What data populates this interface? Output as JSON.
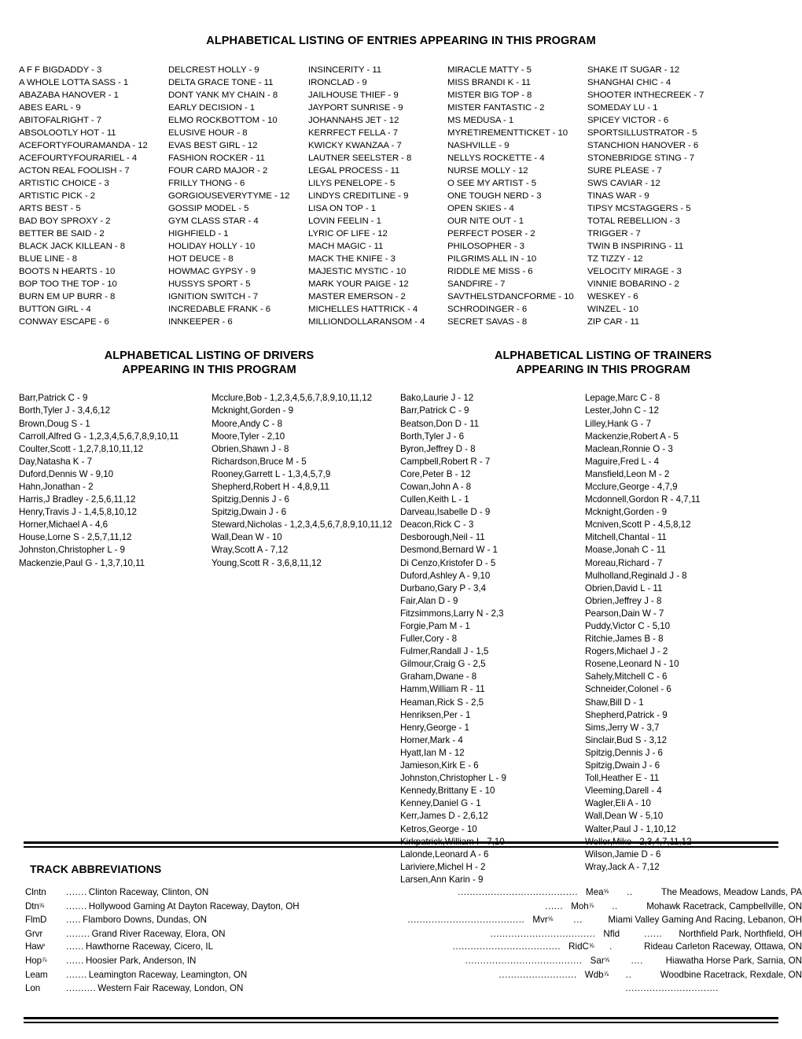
{
  "entries_section": {
    "title": "ALPHABETICAL LISTING OF ENTRIES APPEARING IN THIS PROGRAM",
    "columns": [
      [
        "A F F BIGDADDY - 3",
        "A WHOLE LOTTA SASS - 1",
        "ABAZABA HANOVER - 1",
        "ABES EARL - 9",
        "ABITOFALRIGHT - 7",
        "ABSOLOOTLY HOT - 11",
        "ACEFORTYFOURAMANDA - 12",
        "ACEFOURTYFOURARIEL - 4",
        "ACTON REAL FOOLISH - 7",
        "ARTISTIC CHOICE - 3",
        "ARTISTIC PICK - 2",
        "ARTS BEST - 5",
        "BAD BOY SPROXY - 2",
        "BETTER BE SAID - 2",
        "BLACK JACK KILLEAN - 8",
        "BLUE LINE - 8",
        "BOOTS N HEARTS - 10",
        "BOP TOO THE TOP - 10",
        "BURN EM UP BURR - 8",
        "BUTTON GIRL - 4",
        "CONWAY ESCAPE - 6"
      ],
      [
        "DELCREST HOLLY - 9",
        "DELTA GRACE TONE - 11",
        "DONT YANK MY CHAIN - 8",
        "EARLY DECISION - 1",
        "ELMO ROCKBOTTOM - 10",
        "ELUSIVE HOUR - 8",
        "EVAS BEST GIRL - 12",
        "FASHION ROCKER - 11",
        "FOUR CARD MAJOR - 2",
        "FRILLY THONG - 6",
        "GORGIOUSEVERYTYME - 12",
        "GOSSIP MODEL - 5",
        "GYM CLASS STAR - 4",
        "HIGHFIELD - 1",
        "HOLIDAY HOLLY - 10",
        "HOT DEUCE - 8",
        "HOWMAC GYPSY - 9",
        "HUSSYS SPORT - 5",
        "IGNITION SWITCH - 7",
        "INCREDABLE FRANK - 6",
        "INNKEEPER - 6"
      ],
      [
        "INSINCERITY - 11",
        "IRONCLAD - 9",
        "JAILHOUSE THIEF - 9",
        "JAYPORT SUNRISE - 9",
        "JOHANNAHS JET - 12",
        "KERRFECT FELLA - 7",
        "KWICKY KWANZAA - 7",
        "LAUTNER SEELSTER - 8",
        "LEGAL PROCESS - 11",
        "LILYS PENELOPE - 5",
        "LINDYS CREDITLINE - 9",
        "LISA ON TOP - 1",
        "LOVIN FEELIN - 1",
        "LYRIC OF LIFE - 12",
        "MACH MAGIC - 11",
        "MACK THE KNIFE - 3",
        "MAJESTIC MYSTIC - 10",
        "MARK YOUR PAIGE - 12",
        "MASTER EMERSON - 2",
        "MICHELLES HATTRICK - 4",
        "MILLIONDOLLARANSOM - 4"
      ],
      [
        "MIRACLE MATTY - 5",
        "MISS BRANDI K - 11",
        "MISTER BIG TOP - 8",
        "MISTER FANTASTIC - 2",
        "MS MEDUSA - 1",
        "MYRETIREMENTTICKET - 10",
        "NASHVILLE - 9",
        "NELLYS ROCKETTE - 4",
        "NURSE MOLLY - 12",
        "O SEE MY ARTIST - 5",
        "ONE TOUGH NERD - 3",
        "OPEN SKIES - 4",
        "OUR NITE OUT - 1",
        "PERFECT POSER - 2",
        "PHILOSOPHER - 3",
        "PILGRIMS ALL IN - 10",
        "RIDDLE ME MISS - 6",
        "SANDFIRE - 7",
        "SAVTHELSTDANCFORME - 10",
        "SCHRODINGER - 6",
        "SECRET SAVAS - 8"
      ],
      [
        "SHAKE IT SUGAR - 12",
        "SHANGHAI CHIC - 4",
        "SHOOTER INTHECREEK - 7",
        "SOMEDAY LU - 1",
        "SPICEY VICTOR - 6",
        "SPORTSILLUSTRATOR - 5",
        "STANCHION HANOVER - 6",
        "STONEBRIDGE STING - 7",
        "SURE PLEASE - 7",
        "SWS CAVIAR - 12",
        "TINAS WAR - 9",
        "TIPSY MCSTAGGERS - 5",
        "TOTAL REBELLION - 3",
        "TRIGGER - 7",
        "TWIN B INSPIRING - 11",
        "TZ TIZZY - 12",
        "VELOCITY MIRAGE - 3",
        "VINNIE BOBARINO - 2",
        "WESKEY - 6",
        "WINZEL - 10",
        "ZIP CAR - 11"
      ]
    ]
  },
  "drivers_section": {
    "title_line1": "ALPHABETICAL LISTING OF DRIVERS",
    "title_line2": "APPEARING IN THIS PROGRAM",
    "columns": [
      [
        "Barr,Patrick C - 9",
        "Borth,Tyler J - 3,4,6,12",
        "Brown,Doug S - 1",
        "Carroll,Alfred G - 1,2,3,4,5,6,7,8,9,10,11",
        "Coulter,Scott - 1,2,7,8,10,11,12",
        "Day,Natasha K - 7",
        "Duford,Dennis W - 9,10",
        "Hahn,Jonathan - 2",
        "Harris,J Bradley - 2,5,6,11,12",
        "Henry,Travis J - 1,4,5,8,10,12",
        "Horner,Michael A - 4,6",
        "House,Lorne S - 2,5,7,11,12",
        "Johnston,Christopher L - 9",
        "Mackenzie,Paul G - 1,3,7,10,11"
      ],
      [
        "Mcclure,Bob - 1,2,3,4,5,6,7,8,9,10,11,12",
        "Mcknight,Gorden - 9",
        "Moore,Andy C - 8",
        "Moore,Tyler - 2,10",
        "Obrien,Shawn J - 8",
        "Richardson,Bruce M - 5",
        "Rooney,Garrett L - 1,3,4,5,7,9",
        "Shepherd,Robert H - 4,8,9,11",
        "Spitzig,Dennis J - 6",
        "Spitzig,Dwain J - 6",
        "Steward,Nicholas - 1,2,3,4,5,6,7,8,9,10,11,12",
        "Wall,Dean W - 10",
        "Wray,Scott A - 7,12",
        "Young,Scott R - 3,6,8,11,12"
      ]
    ]
  },
  "trainers_section": {
    "title_line1": "ALPHABETICAL LISTING OF TRAINERS",
    "title_line2": "APPEARING IN THIS PROGRAM",
    "columns": [
      [
        "Bako,Laurie J - 12",
        "Barr,Patrick C - 9",
        "Beatson,Don D - 11",
        "Borth,Tyler J - 6",
        "Byron,Jeffrey D - 8",
        "Campbell,Robert R - 7",
        "Core,Peter B - 12",
        "Cowan,John A - 8",
        "Cullen,Keith L - 1",
        "Darveau,Isabelle D - 9",
        "Deacon,Rick C - 3",
        "Desborough,Neil - 11",
        "Desmond,Bernard W - 1",
        "Di Cenzo,Kristofer D - 5",
        "Duford,Ashley A - 9,10",
        "Durbano,Gary P - 3,4",
        "Fair,Alan D - 9",
        "Fitzsimmons,Larry N - 2,3",
        "Forgie,Pam M - 1",
        "Fuller,Cory - 8",
        "Fulmer,Randall J - 1,5",
        "Gilmour,Craig G - 2,5",
        "Graham,Dwane - 8",
        "Hamm,William R - 11",
        "Heaman,Rick S - 2,5",
        "Henriksen,Per - 1",
        "Henry,George - 1",
        "Horner,Mark - 4",
        "Hyatt,Ian M - 12",
        "Jamieson,Kirk E - 6",
        "Johnston,Christopher L - 9",
        "Kennedy,Brittany E - 10",
        "Kenney,Daniel G - 1",
        "Kerr,James D - 2,6,12",
        "Ketros,George - 10",
        "Kirkpatrick,William I - 7,10",
        "Lalonde,Leonard A - 6",
        "Lariviere,Michel H - 2",
        "Larsen,Ann Karin - 9"
      ],
      [
        "Lepage,Marc C - 8",
        "Lester,John C - 12",
        "Lilley,Hank G - 7",
        "Mackenzie,Robert A - 5",
        "Maclean,Ronnie O - 3",
        "Maguire,Fred L - 4",
        "Mansfield,Leon M - 2",
        "Mcclure,George - 4,7,9",
        "Mcdonnell,Gordon R - 4,7,11",
        "Mcknight,Gorden - 9",
        "Mcniven,Scott P - 4,5,8,12",
        "Mitchell,Chantal - 11",
        "Moase,Jonah C - 11",
        "Moreau,Richard - 7",
        "Mulholland,Reginald J - 8",
        "Obrien,David L - 11",
        "Obrien,Jeffrey J - 8",
        "Pearson,Dain W - 7",
        "Puddy,Victor C - 5,10",
        "Ritchie,James B - 8",
        "Rogers,Michael J - 2",
        "Rosene,Leonard N - 10",
        "Sahely,Mitchell C - 6",
        "Schneider,Colonel - 6",
        "Shaw,Bill D - 1",
        "Shepherd,Patrick - 9",
        "Sims,Jerry W - 3,7",
        "Sinclair,Bud S - 3,12",
        "Spitzig,Dennis J - 6",
        "Spitzig,Dwain J - 6",
        "Toll,Heather E - 11",
        "Vleeming,Darell - 4",
        "Wagler,Eli A - 10",
        "Wall,Dean W - 5,10",
        "Walter,Paul J - 1,10,12",
        "Weller,Mike - 2,3,4,7,11,12",
        "Wilson,Jamie D - 6",
        "Wray,Jack A - 7,12"
      ]
    ]
  },
  "track_abbreviations": {
    "title": "TRACK ABBREVIATIONS",
    "rows": [
      {
        "left_code": "Clntn",
        "left_dots": ".......",
        "left_name": "Clinton Raceway, Clinton, ON",
        "mid_dots": "........................................",
        "right_code": "Mea⅝",
        "right_dots": "..",
        "right_name": "The Meadows, Meadow Lands, PA"
      },
      {
        "left_code": "Dtn⅝",
        "left_dots": ".......",
        "left_name": "Hollywood Gaming At Dayton Raceway, Dayton, OH",
        "mid_dots": "......",
        "right_code": "Moh⅞",
        "right_dots": "..",
        "right_name": "Mohawk Racetrack, Campbellville, ON"
      },
      {
        "left_code": "FlmD",
        "left_dots": ".....",
        "left_name": "Flamboro Downs, Dundas, ON",
        "mid_dots": ".......................................",
        "right_code": "Mvr⅝",
        "right_dots": "...",
        "right_name": "Miami Valley Gaming And Racing, Lebanon, OH"
      },
      {
        "left_code": "Grvr",
        "left_dots": "........",
        "left_name": "Grand River Raceway, Elora, ON",
        "mid_dots": "...................................",
        "right_code": "Nfld",
        "right_dots": "......",
        "right_name": "Northfield Park, Northfield, OH"
      },
      {
        "left_code": "Haw¹",
        "left_dots": "......",
        "left_name": "Hawthorne Raceway, Cicero, IL",
        "mid_dots": "....................................",
        "right_code": "RidC⅝",
        "right_dots": ".",
        "right_name": "Rideau Carleton Raceway, Ottawa, ON"
      },
      {
        "left_code": "Hop⅞",
        "left_dots": "......",
        "left_name": "Hoosier Park, Anderson, IN",
        "mid_dots": ".......................................",
        "right_code": "Sar⅝",
        "right_dots": "....",
        "right_name": "Hiawatha Horse Park, Sarnia, ON"
      },
      {
        "left_code": "Leam",
        "left_dots": ".......",
        "left_name": "Leamington Raceway, Leamington, ON",
        "mid_dots": "..........................",
        "right_code": "Wdb⅞",
        "right_dots": "..",
        "right_name": "Woodbine Racetrack, Rexdale, ON"
      },
      {
        "left_code": "Lon",
        "left_dots": "..........",
        "left_name": "Western Fair Raceway, London, ON",
        "mid_dots": "...............................",
        "right_code": "",
        "right_dots": "",
        "right_name": ""
      }
    ]
  }
}
